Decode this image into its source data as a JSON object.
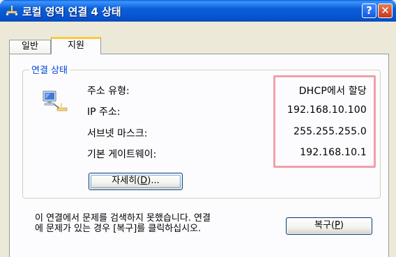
{
  "window": {
    "title": "로컬 영역 연결 4 상태",
    "help_label": "?",
    "close_label": "✕"
  },
  "tabs": [
    {
      "label": "일반",
      "selected": false
    },
    {
      "label": "지원",
      "selected": true
    }
  ],
  "connection_status": {
    "title": "연결 상태",
    "rows": [
      {
        "label": "주소 유형:",
        "value": "DHCP에서 할당"
      },
      {
        "label": "IP 주소:",
        "value": "192.168.10.100"
      },
      {
        "label": "서브넷 마스크:",
        "value": "255.255.255.0"
      },
      {
        "label": "기본 게이트웨이:",
        "value": "192.168.10.1"
      }
    ],
    "details_button": {
      "text": "자세히(",
      "mnemonic": "D",
      "suffix": ")..."
    }
  },
  "repair": {
    "message_line1": "이 연결에서 문제를 검색하지 못했습니다. 연결",
    "message_line2": "에 문제가 있는 경우 [복구]를 클릭하십시오.",
    "button": {
      "text": "복구(",
      "mnemonic": "P",
      "suffix": ")"
    }
  },
  "colors": {
    "highlight_border": "#f2a0a8",
    "group_title": "#0046d5",
    "titlebar": "#0a5fd8"
  }
}
